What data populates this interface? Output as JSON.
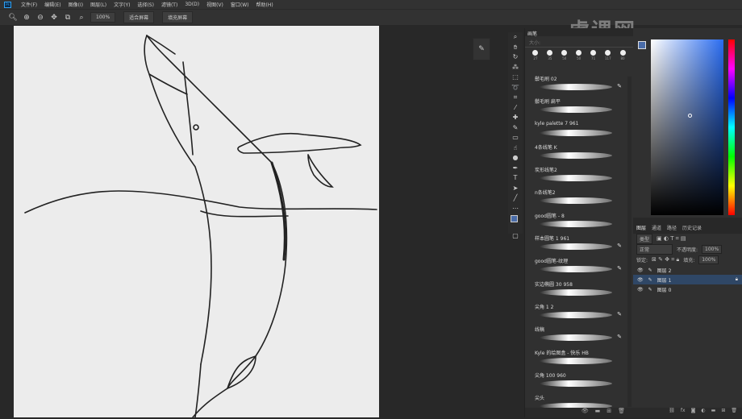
{
  "menubar": {
    "items": [
      "文件(F)",
      "编辑(E)",
      "图像(I)",
      "图层(L)",
      "文字(Y)",
      "选择(S)",
      "滤镜(T)",
      "3D(D)",
      "视图(V)",
      "窗口(W)",
      "帮助(H)"
    ]
  },
  "options": {
    "zoom": "100%",
    "fit_screen": "适合屏幕",
    "fill_screen": "填充屏幕"
  },
  "watermark": "虎课网",
  "brush_panel": {
    "title": "画笔",
    "size_label": "大小:",
    "tip_sizes": [
      "27",
      "35",
      "50",
      "50",
      "71",
      "117",
      "80"
    ],
    "brushes": [
      {
        "name": "鬃毛刷 02",
        "pen": true
      },
      {
        "name": "鬃毛刷 扁平",
        "pen": false
      },
      {
        "name": "kyle palette 7 961",
        "pen": false
      },
      {
        "name": "4条线笔 K",
        "pen": false
      },
      {
        "name": "炭形线笔2",
        "pen": false
      },
      {
        "name": "n条线笔2",
        "pen": false
      },
      {
        "name": "good圆笔 - 8",
        "pen": false
      },
      {
        "name": "样本圆笔 1 961",
        "pen": true
      },
      {
        "name": "good圆笔-纹理",
        "pen": true
      },
      {
        "name": "实边椭圆 30 958",
        "pen": false
      },
      {
        "name": "尖角 1 2",
        "pen": true
      },
      {
        "name": "线稿",
        "pen": true
      },
      {
        "name": "Kyle 的绘图盒 - 快乐 HB",
        "pen": false
      },
      {
        "name": "尖角 100 960",
        "pen": false
      },
      {
        "name": "尖头",
        "pen": false
      }
    ]
  },
  "layers_panel": {
    "tabs": [
      "图层",
      "通道",
      "路径",
      "历史记录"
    ],
    "filter": "类型",
    "blend_mode": "正常",
    "opacity_label": "不透明度:",
    "opacity": "100%",
    "lock_label": "锁定:",
    "fill_label": "填充:",
    "fill": "100%",
    "layers": [
      {
        "name": "图层 2",
        "active": false
      },
      {
        "name": "图层 1",
        "active": true
      },
      {
        "name": "图层 0",
        "active": false
      }
    ]
  },
  "colors": {
    "foreground": "#4a6ca8",
    "canvas": "#ececec"
  }
}
